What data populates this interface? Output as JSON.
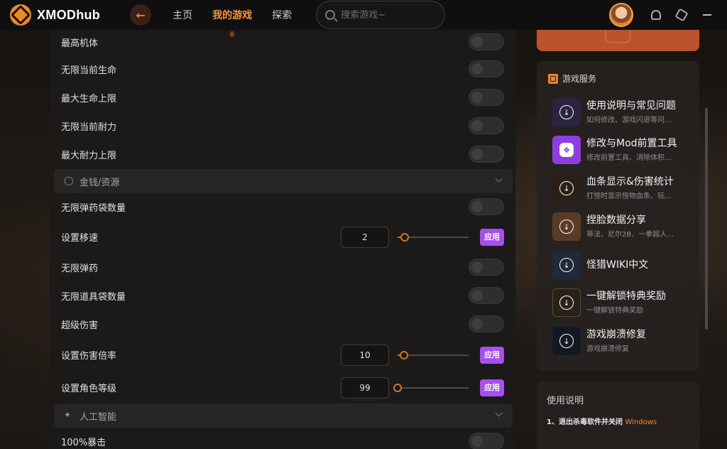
{
  "app": {
    "logo_text": "XMODhub"
  },
  "nav": {
    "home": "主页",
    "my_games": "我的游戏",
    "explore": "探索"
  },
  "search": {
    "placeholder": "搜索游戏~"
  },
  "left": {
    "rows_top": [
      {
        "label": "最高机体"
      },
      {
        "label": "无限当前生命"
      },
      {
        "label": "最大生命上限"
      },
      {
        "label": "无限当前耐力"
      },
      {
        "label": "最大耐力上限"
      }
    ],
    "section_money": "金钱/资源",
    "rows_money": [
      {
        "label": "无限弹药袋数量"
      },
      {
        "label": "设置移速",
        "value": "2",
        "apply": "应用",
        "slider_fraction": 0.08
      },
      {
        "label": "无限弹药"
      },
      {
        "label": "无限道具袋数量"
      },
      {
        "label": "超级伤害"
      },
      {
        "label": "设置伤害倍率",
        "value": "10",
        "apply": "应用",
        "slider_fraction": 0.08
      },
      {
        "label": "设置角色等级",
        "value": "99",
        "apply": "应用",
        "slider_fraction": 0.0
      }
    ],
    "section_ai": "人工智能",
    "rows_ai": [
      {
        "label": "100%暴击"
      }
    ]
  },
  "services": {
    "title": "游戏服务",
    "items": [
      {
        "name": "使用说明与常见问题",
        "desc": "如何修改、游戏闪退等问…",
        "color": "#2a2440"
      },
      {
        "name": "修改与Mod前置工具",
        "desc": "修改前置工具、消除体积…",
        "color": "#8e3ee0"
      },
      {
        "name": "血条显示&伤害统计",
        "desc": "打怪时显示怪物血条、玩…",
        "color": "#2b2018"
      },
      {
        "name": "捏脸数据分享",
        "desc": "蒂法、尼尔2B、一拳超人…",
        "color": "#5a3c26"
      },
      {
        "name": "怪猎WIKI中文",
        "desc": "",
        "color": "#1e2a3a"
      },
      {
        "name": "一键解锁特典奖励",
        "desc": "一键解锁特典奖励",
        "color": "#2a2116"
      },
      {
        "name": "游戏崩溃修复",
        "desc": "游戏崩溃修复",
        "color": "#141824"
      }
    ]
  },
  "usage": {
    "title": "使用说明",
    "step1": "1、退出杀毒软件并关闭",
    "step1_highlight": "Windows"
  }
}
